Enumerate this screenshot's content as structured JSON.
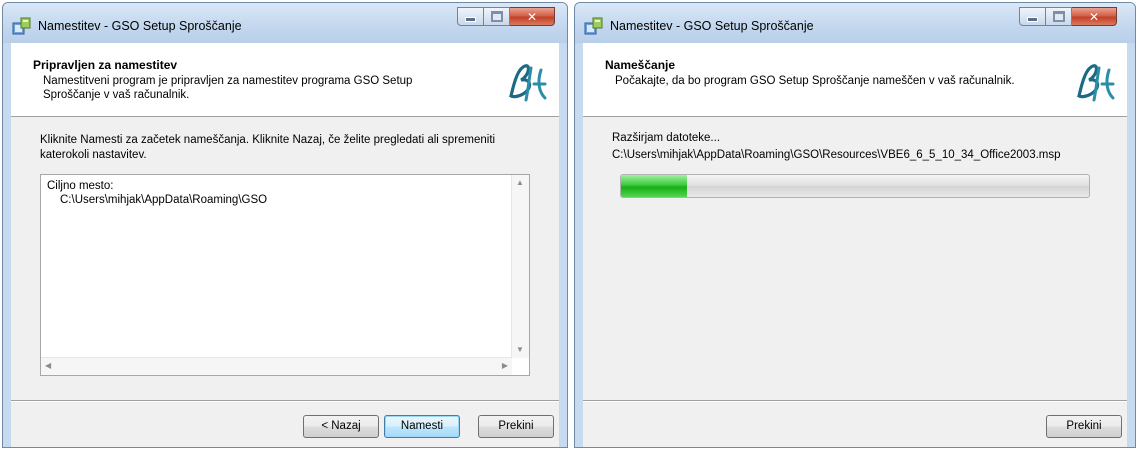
{
  "colors": {
    "titlebar": "#c7daf0",
    "close_button": "#c34128",
    "progress": "#16b016",
    "default_button_border": "#3c7fb1"
  },
  "windows": [
    {
      "title": "Namestitev - GSO Setup Sproščanje",
      "header_title": "Pripravljen za namestitev",
      "header_subtitle": "Namestitveni program je pripravljen za namestitev programa GSO Setup Sproščanje v vaš računalnik.",
      "body_text": "Kliknite Namesti za začetek nameščanja. Kliknite Nazaj, če želite pregledati ali spremeniti katerokoli nastavitev.",
      "memo": {
        "line1": "Ciljno mesto:",
        "line2": "C:\\Users\\mihjak\\AppData\\Roaming\\GSO"
      },
      "buttons": {
        "back": "< Nazaj",
        "install": "Namesti",
        "cancel": "Prekini"
      }
    },
    {
      "title": "Namestitev - GSO Setup Sproščanje",
      "header_title": "Nameščanje",
      "header_subtitle": "Počakajte, da bo program GSO Setup Sproščanje nameščen v vaš računalnik.",
      "status": "Razširjam datoteke...",
      "file_path": "C:\\Users\\mihjak\\AppData\\Roaming\\GSO\\Resources\\VBE6_6_5_10_34_Office2003.msp",
      "progress_fraction": 0.14,
      "buttons": {
        "cancel": "Prekini"
      }
    }
  ],
  "icons": {
    "app": "installer-icon",
    "logo": "gso-logo-icon",
    "minimize": "minimize-icon",
    "maximize": "maximize-icon",
    "close": "close-icon"
  }
}
